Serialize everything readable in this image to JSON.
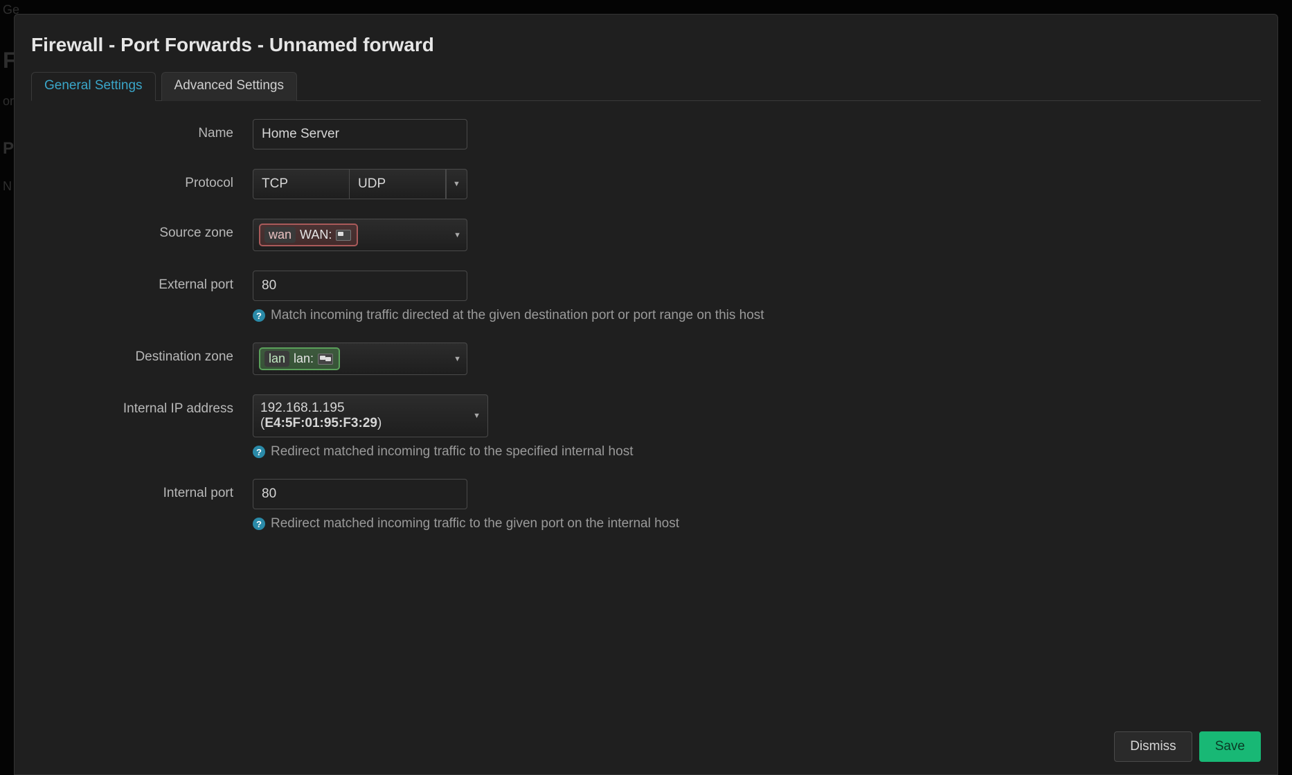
{
  "bg": {
    "topFrag": "Ge",
    "heading": "Fi",
    "desc": "or",
    "section": "Po",
    "colhead": "N"
  },
  "modal": {
    "title": "Firewall - Port Forwards - Unnamed forward",
    "tabs": {
      "general": "General Settings",
      "advanced": "Advanced Settings"
    },
    "labels": {
      "name": "Name",
      "protocol": "Protocol",
      "sourceZone": "Source zone",
      "externalPort": "External port",
      "destZone": "Destination zone",
      "internalIp": "Internal IP address",
      "internalPort": "Internal port"
    },
    "values": {
      "name": "Home Server",
      "protocol1": "TCP",
      "protocol2": "UDP",
      "sourceZoneTag": "wan",
      "sourceZoneText": "WAN:",
      "externalPort": "80",
      "destZoneTag": "lan",
      "destZoneText": "lan:",
      "internalIpAddr": "192.168.1.195",
      "internalIpMac": "E4:5F:01:95:F3:29",
      "internalPort": "80"
    },
    "hints": {
      "externalPort": "Match incoming traffic directed at the given destination port or port range on this host",
      "internalIp": "Redirect matched incoming traffic to the specified internal host",
      "internalPort": "Redirect matched incoming traffic to the given port on the internal host"
    },
    "buttons": {
      "dismiss": "Dismiss",
      "save": "Save"
    }
  }
}
